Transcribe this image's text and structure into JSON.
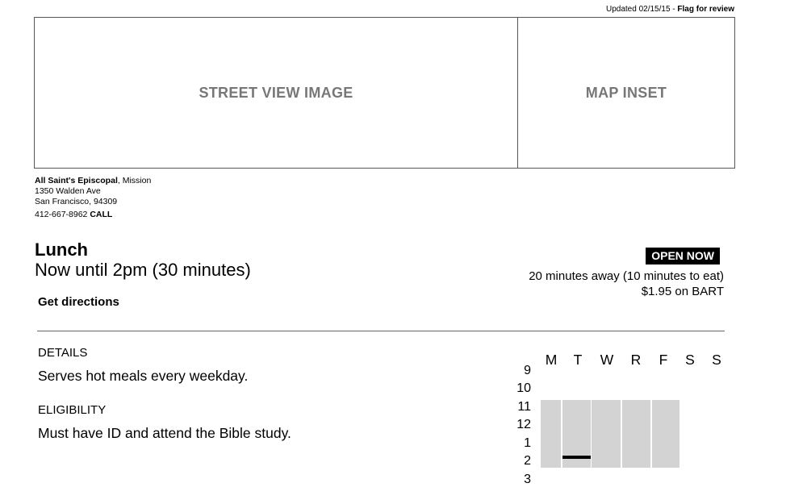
{
  "header": {
    "updated": "Updated 02/15/15",
    "separator": "-",
    "flag_label": "Flag for review"
  },
  "media": {
    "street_view_label": "STREET VIEW IMAGE",
    "map_inset_label": "MAP INSET"
  },
  "location": {
    "name": "All Saint's Episcopal",
    "neighborhood": ", Mission",
    "street": "1350 Walden Ave",
    "city": "San Francisco, 94309",
    "phone": "412-667-8962",
    "call_label": "CALL"
  },
  "meal": {
    "title": "Lunch",
    "time": "Now until 2pm (30 minutes)",
    "directions_label": "Get directions"
  },
  "status": {
    "badge": "OPEN NOW",
    "travel_time": "20 minutes away (10 minutes to eat)",
    "fare": "$1.95 on BART"
  },
  "details": {
    "label": "DETAILS",
    "text": "Serves hot meals every weekday."
  },
  "eligibility": {
    "label": "ELIGIBILITY",
    "text": "Must have ID and attend the Bible study."
  },
  "schedule": {
    "days": [
      "M",
      "T",
      "W",
      "R",
      "F",
      "S",
      "S"
    ],
    "hours": [
      "9",
      "10",
      "11",
      "12",
      "1",
      "2",
      "3"
    ],
    "open_days": [
      "M",
      "T",
      "W",
      "R",
      "F"
    ],
    "open_from": "11",
    "open_until": "2",
    "current_day": "T",
    "block_color": "#d3d3d3"
  }
}
